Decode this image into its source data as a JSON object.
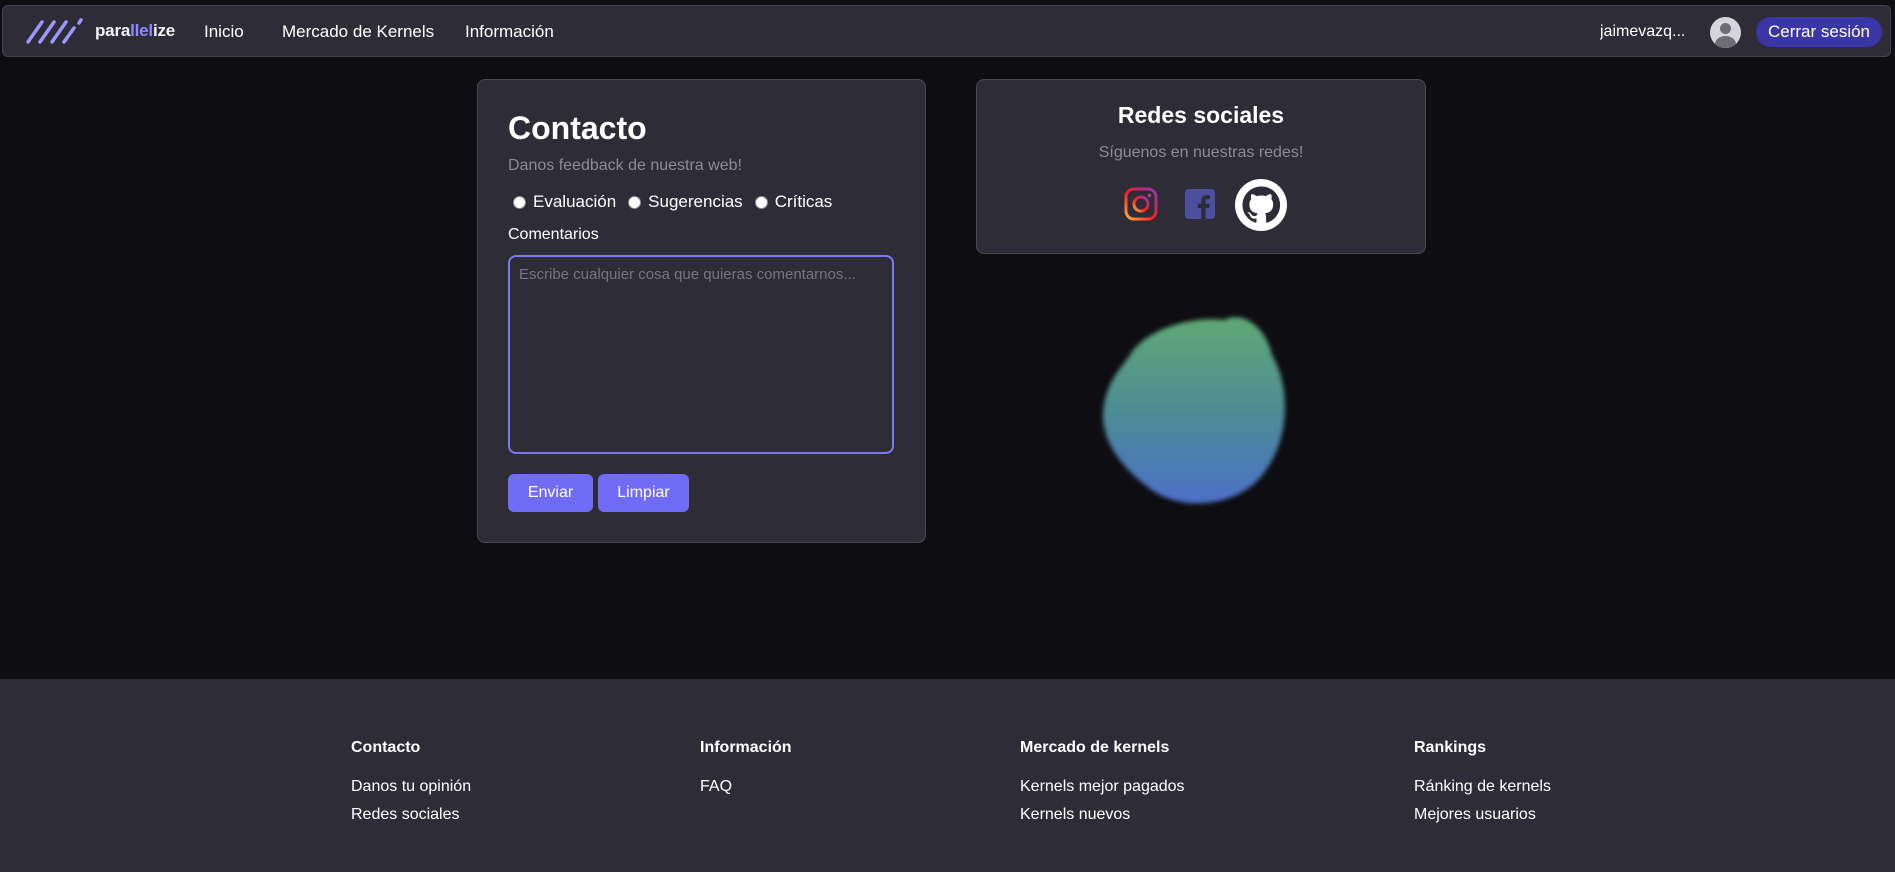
{
  "colors": {
    "background": "#0d0d12",
    "surface": "#2e2c36",
    "accent": "#716cf5",
    "logout": "#3a36a6",
    "muted_text": "#8d8b96"
  },
  "navbar": {
    "logo": {
      "prefix": "para",
      "accent": "llel",
      "suffix": "ize",
      "icon": "slash-lines-logo-icon"
    },
    "links": [
      "Inicio",
      "Mercado de Kernels",
      "Información"
    ],
    "username": "jaimevazq...",
    "avatar_icon": "user-avatar-icon",
    "logout_label": "Cerrar sesión"
  },
  "contact": {
    "title": "Contacto",
    "subtitle": "Danos feedback de nuestra web!",
    "options": [
      "Evaluación",
      "Sugerencias",
      "Críticas"
    ],
    "comments_label": "Comentarios",
    "comments_placeholder": "Escribe cualquier cosa que quieras comentarnos...",
    "comments_value": "",
    "send_label": "Enviar",
    "clear_label": "Limpiar"
  },
  "social": {
    "title": "Redes sociales",
    "subtitle": "Síguenos en nuestras redes!",
    "icons": [
      "instagram-icon",
      "facebook-icon",
      "github-icon"
    ]
  },
  "footer": {
    "columns": [
      {
        "title": "Contacto",
        "links": [
          "Danos tu opinión",
          "Redes sociales"
        ]
      },
      {
        "title": "Información",
        "links": [
          "FAQ"
        ]
      },
      {
        "title": "Mercado de kernels",
        "links": [
          "Kernels mejor pagados",
          "Kernels nuevos"
        ]
      },
      {
        "title": "Rankings",
        "links": [
          "Ránking de kernels",
          "Mejores usuarios"
        ]
      }
    ]
  }
}
